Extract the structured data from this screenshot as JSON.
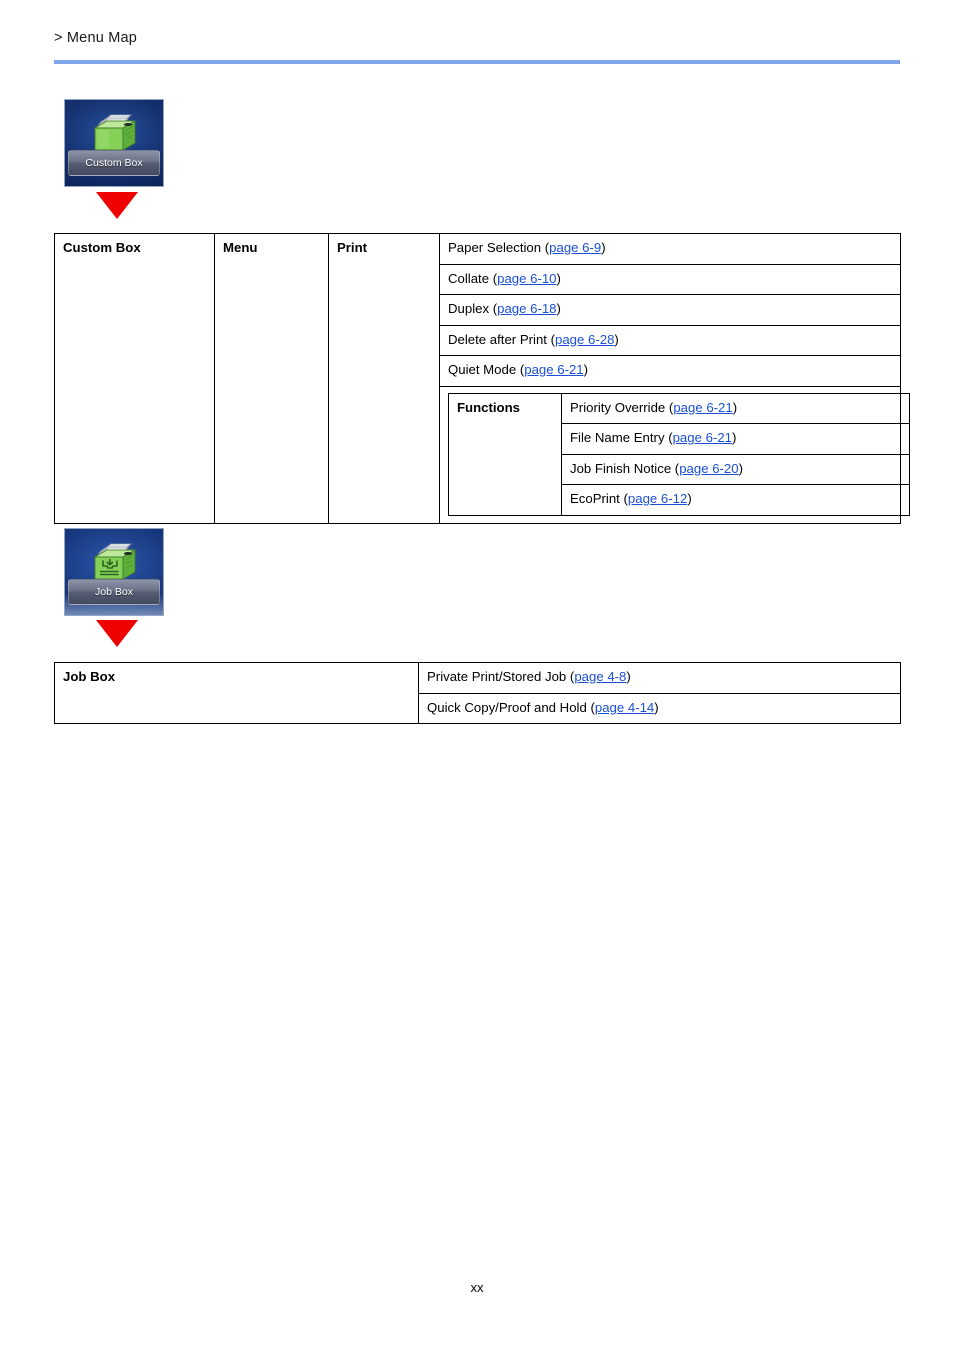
{
  "header": {
    "breadcrumb": "> Menu Map",
    "rule_color": "#7fa5e8"
  },
  "icons": [
    {
      "id": "custom-box",
      "label": "Custom Box",
      "graphic": "green-box-with-documents-icon",
      "background_color": "#14306e"
    },
    {
      "id": "job-box",
      "label": "Job Box",
      "graphic": "green-box-with-inbox-tray-icon",
      "background_color": "#16357a"
    }
  ],
  "arrow": {
    "glyph": "red-down-triangle-icon",
    "color": "#ee0000"
  },
  "custom_box_table": {
    "col1": "Custom Box",
    "col2": "Menu",
    "col3": "Print",
    "items": [
      {
        "text": "Paper Selection (",
        "link": "page 6-9",
        "tail": ")"
      },
      {
        "text": "Collate (",
        "link": "page 6-10",
        "tail": ")"
      },
      {
        "text": "Duplex (",
        "link": "page 6-18",
        "tail": ")"
      },
      {
        "text": "Delete after Print (",
        "link": "page 6-28",
        "tail": ")"
      },
      {
        "text": "Quiet Mode (",
        "link": "page 6-21",
        "tail": ")"
      }
    ],
    "functions_label": "Functions",
    "functions": [
      {
        "text": "Priority Override (",
        "link": "page 6-21",
        "tail": ")"
      },
      {
        "text": "File Name Entry (",
        "link": "page 6-21",
        "tail": ")"
      },
      {
        "text": "Job Finish Notice (",
        "link": "page 6-20",
        "tail": ")"
      },
      {
        "text": "EcoPrint (",
        "link": "page 6-12",
        "tail": ")"
      }
    ]
  },
  "job_box_table": {
    "col1": "Job Box",
    "items": [
      {
        "text": "Private Print/Stored Job (",
        "link": "page 4-8",
        "tail": ")"
      },
      {
        "text": "Quick Copy/Proof and Hold (",
        "link": "page 4-14",
        "tail": ")"
      }
    ]
  },
  "footer": {
    "page_number": "xx"
  }
}
